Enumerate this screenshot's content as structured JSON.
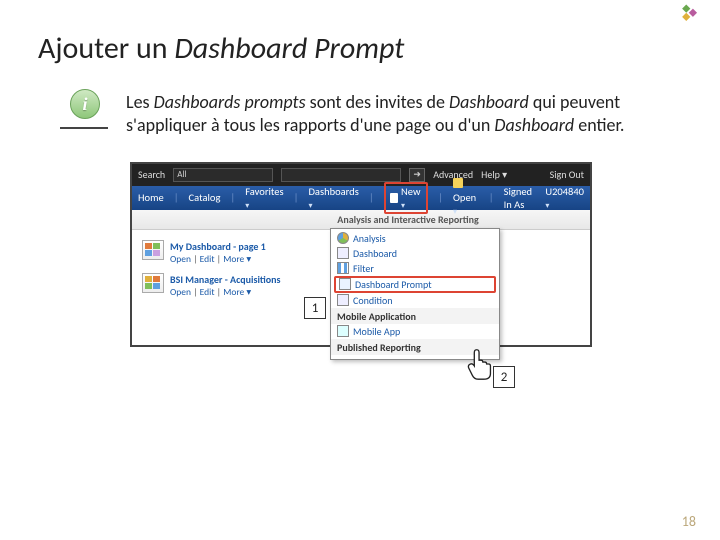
{
  "logo": {
    "alt": "logo"
  },
  "title": {
    "prefix": "Ajouter un ",
    "italic": "Dashboard Prompt"
  },
  "intro": {
    "t1": "Les ",
    "i1": "Dashboards prompts",
    "t2": " sont des invites de ",
    "i2": "Dashboard",
    "t3": " qui peuvent s'appliquer à tous les rapports d'une page ou d'un ",
    "i3": "Dashboard",
    "t4": " entier."
  },
  "info_glyph": "i",
  "shot": {
    "topbar": {
      "search_label": "Search",
      "search_scope": "All",
      "advanced": "Advanced",
      "help": "Help ▾",
      "signout": "Sign Out"
    },
    "bluebar": {
      "home": "Home",
      "catalog": "Catalog",
      "favorites": "Favorites",
      "dashboards": "Dashboards",
      "new": "New",
      "open": "Open",
      "signed_in": "Signed In As",
      "user": "U204840"
    },
    "graybar": "Analysis and Interactive Reporting",
    "left": {
      "items": [
        {
          "label": "My Dashboard - page 1",
          "sub": [
            "Open",
            "Edit",
            "More ▾"
          ]
        },
        {
          "label": "BSI Manager - Acquisitions",
          "sub": [
            "Open",
            "Edit",
            "More ▾"
          ]
        }
      ]
    },
    "menu": {
      "sections": [
        {
          "items": [
            "Analysis",
            "Dashboard",
            "Filter",
            "Dashboard Prompt",
            "Condition"
          ]
        },
        {
          "head": "Mobile Application",
          "items": [
            "Mobile App"
          ]
        },
        {
          "head": "Published Reporting",
          "items": []
        }
      ],
      "highlight": "Dashboard Prompt"
    }
  },
  "callouts": {
    "c1": "1",
    "c2": "2"
  },
  "page_number": "18"
}
